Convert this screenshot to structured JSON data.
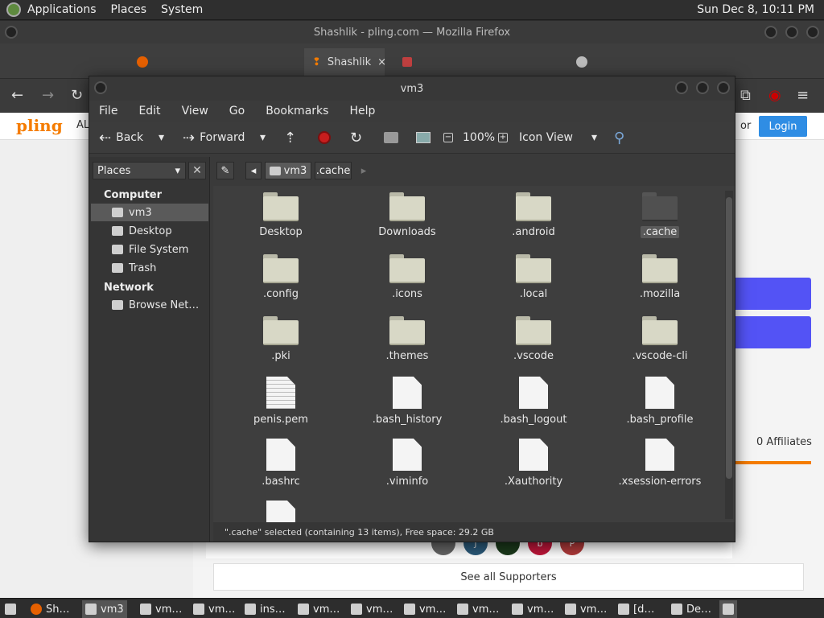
{
  "top_panel": {
    "menu": [
      "Applications",
      "Places",
      "System"
    ],
    "clock": "Sun Dec 8, 10:11 PM"
  },
  "firefox": {
    "title": "Shashlik - pling.com — Mozilla Firefox",
    "active_tab": "Shashlik",
    "page": {
      "logo": "pling",
      "al": "AL",
      "or": "or",
      "login": "Login",
      "affiliates": "0 Affiliates",
      "see_all_supporters": "See all Supporters",
      "supporter_avatars": [
        "J",
        "b",
        "P"
      ]
    }
  },
  "filemanager": {
    "title": "vm3",
    "menu": [
      "File",
      "Edit",
      "View",
      "Go",
      "Bookmarks",
      "Help"
    ],
    "toolbar": {
      "back": "Back",
      "forward": "Forward",
      "zoom": "100%",
      "view": "Icon View"
    },
    "sidebar": {
      "combo": "Places",
      "sections": [
        {
          "title": "Computer",
          "items": [
            "vm3",
            "Desktop",
            "File System",
            "Trash"
          ]
        },
        {
          "title": "Network",
          "items": [
            "Browse Net…"
          ]
        }
      ],
      "selected": "vm3"
    },
    "path": [
      "vm3",
      ".cache"
    ],
    "items": [
      {
        "name": "Desktop",
        "type": "folder"
      },
      {
        "name": "Downloads",
        "type": "folder"
      },
      {
        "name": ".android",
        "type": "folder"
      },
      {
        "name": ".cache",
        "type": "folder-selected"
      },
      {
        "name": ".config",
        "type": "folder"
      },
      {
        "name": ".icons",
        "type": "folder"
      },
      {
        "name": ".local",
        "type": "folder"
      },
      {
        "name": ".mozilla",
        "type": "folder"
      },
      {
        "name": ".pki",
        "type": "folder"
      },
      {
        "name": ".themes",
        "type": "folder"
      },
      {
        "name": ".vscode",
        "type": "folder"
      },
      {
        "name": ".vscode-cli",
        "type": "folder"
      },
      {
        "name": "penis.pem",
        "type": "file-text"
      },
      {
        "name": ".bash_history",
        "type": "file"
      },
      {
        "name": ".bash_logout",
        "type": "file"
      },
      {
        "name": ".bash_profile",
        "type": "file"
      },
      {
        "name": ".bashrc",
        "type": "file"
      },
      {
        "name": ".viminfo",
        "type": "file"
      },
      {
        "name": ".Xauthority",
        "type": "file"
      },
      {
        "name": ".xsession-errors",
        "type": "file"
      }
    ],
    "status": "\".cache\" selected (containing 13 items), Free space: 29.2 GB"
  },
  "taskbar": {
    "tasks": [
      "Sh…",
      "vm3",
      "vm…",
      "vm…",
      "ins…",
      "vm…",
      "vm…",
      "vm…",
      "vm…",
      "vm…",
      "vm…",
      "[d…",
      "De…"
    ],
    "active": 1
  },
  "colors": {
    "accent_login": "#2f8de4",
    "pling_orange": "#f57c00",
    "blue_buttons": "#5353f5"
  }
}
